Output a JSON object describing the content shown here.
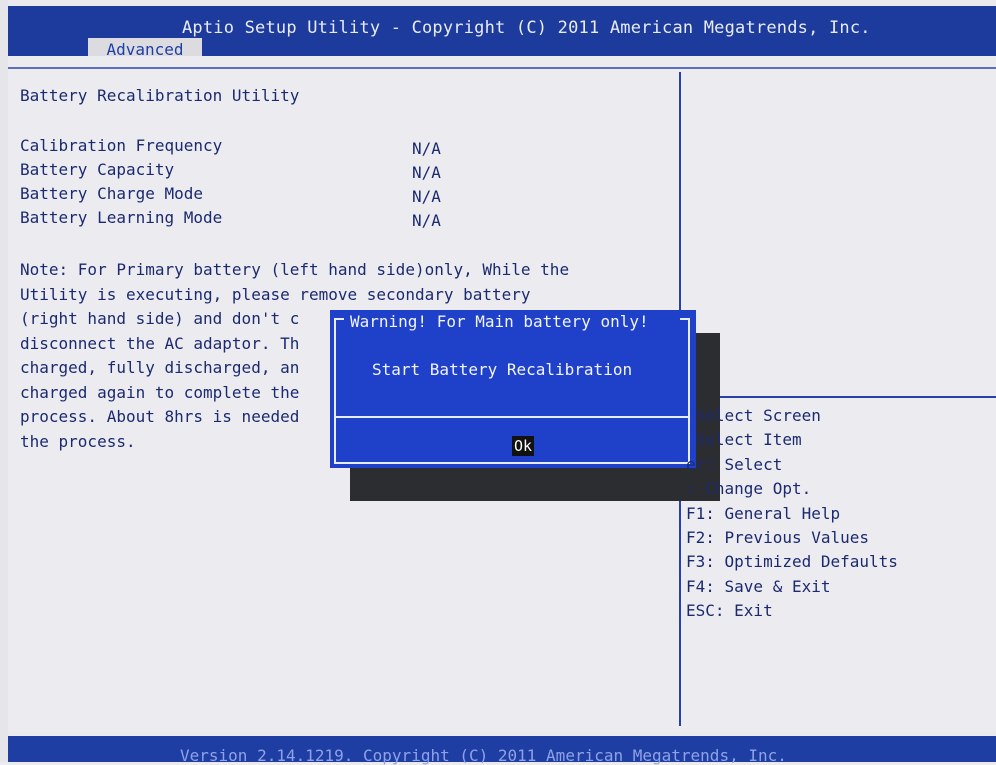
{
  "header": {
    "title": "Aptio Setup Utility - Copyright (C) 2011 American Megatrends, Inc.",
    "tab_active": "Advanced"
  },
  "main": {
    "section_title": "Battery Recalibration Utility",
    "settings": [
      {
        "label": "Calibration Frequency",
        "value": "N/A"
      },
      {
        "label": "Battery Capacity",
        "value": "N/A"
      },
      {
        "label": "Battery Charge Mode",
        "value": "N/A"
      },
      {
        "label": "Battery Learning Mode",
        "value": "N/A"
      }
    ],
    "note_lines": [
      "Note: For Primary battery (left hand side)only, While the",
      "Utility is executing, please remove secondary battery",
      "(right hand side) and don't c",
      "disconnect the AC adaptor. Th",
      "charged, fully discharged, an",
      "charged again to complete the",
      "process. About 8hrs is needed",
      "the process."
    ]
  },
  "dialog": {
    "title": "Warning! For Main battery only!",
    "message": "Start Battery Recalibration",
    "ok_label": "Ok"
  },
  "help": {
    "items": [
      " Select Screen",
      " Select Item",
      "er: Select",
      ": Change Opt.",
      "F1: General Help",
      "F2: Previous Values",
      "F3: Optimized Defaults",
      "F4: Save & Exit",
      "ESC: Exit"
    ]
  },
  "footer": {
    "text": "Version 2.14.1219. Copyright (C) 2011 American Megatrends, Inc."
  },
  "colors": {
    "header_blue": "#1c3b9c",
    "dialog_blue": "#1f40c8",
    "text_blue": "#1b2a70",
    "panel_bg": "#ececf0"
  }
}
